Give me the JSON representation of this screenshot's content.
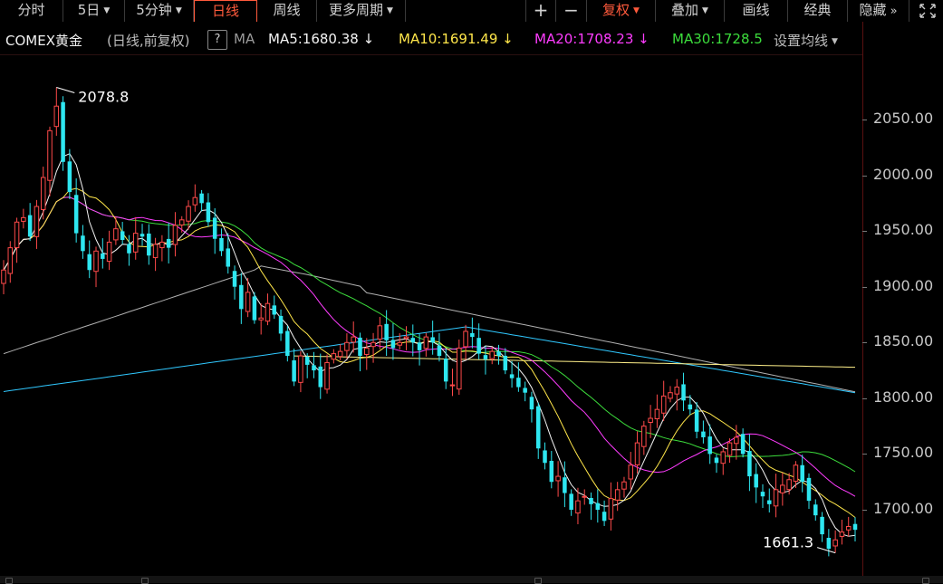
{
  "toolbar": {
    "left_tabs": [
      {
        "label": "分时",
        "dropdown": false,
        "active": false
      },
      {
        "label": "5日",
        "dropdown": true,
        "active": false
      },
      {
        "label": "5分钟",
        "dropdown": true,
        "active": false
      },
      {
        "label": "日线",
        "dropdown": false,
        "active": true
      },
      {
        "label": "周线",
        "dropdown": false,
        "active": false
      },
      {
        "label": "更多周期",
        "dropdown": true,
        "active": false
      }
    ],
    "zoom_in": "+",
    "zoom_out": "−",
    "right_buttons": [
      {
        "label": "复权",
        "dropdown": true,
        "highlight": true
      },
      {
        "label": "叠加",
        "dropdown": true,
        "highlight": false
      },
      {
        "label": "画线",
        "dropdown": false,
        "highlight": false
      },
      {
        "label": "经典",
        "dropdown": false,
        "highlight": false
      },
      {
        "label": "隐藏",
        "dropdown": false,
        "highlight": false
      }
    ],
    "hide_arrow": "»",
    "fullscreen_icon": "fullscreen-icon"
  },
  "legend": {
    "name": "COMEX黄金",
    "sub": "(日线,前复权)",
    "help": "?",
    "ma_label": "MA",
    "ma5": "MA5:1680.38",
    "ma10": "MA10:1691.49",
    "ma20": "MA20:1708.23",
    "ma30": "MA30:1728.5",
    "arrow_down": "↓",
    "settings": "设置均线"
  },
  "colors": {
    "up": "#ff4a4a",
    "down": "#2ee6f0",
    "ma5": "#f4f4f4",
    "ma10": "#ffe64a",
    "ma20": "#ff3cff",
    "ma30": "#3cdc3c",
    "ma60": "#cfcfcf",
    "ma120": "#30c8ff",
    "ma250": "#fff08a",
    "accent": "#ff5a3c"
  },
  "chart_data": {
    "type": "candlestick",
    "y_ticks": [
      "2050.00",
      "2000.00",
      "1950.00",
      "1900.00",
      "1850.00",
      "1800.00",
      "1750.00",
      "1700.00"
    ],
    "ylim": [
      1657,
      2085
    ],
    "high_label": "2078.8",
    "low_label": "1661.3",
    "closes": [
      1915,
      1935,
      1958,
      1962,
      1945,
      1972,
      1998,
      2040,
      2062,
      2012,
      1985,
      1948,
      1932,
      1915,
      1932,
      1925,
      1940,
      1952,
      1942,
      1930,
      1948,
      1945,
      1928,
      1938,
      1940,
      1935,
      1955,
      1960,
      1972,
      1980,
      1975,
      1958,
      1943,
      1932,
      1918,
      1900,
      1880,
      1895,
      1870,
      1872,
      1885,
      1875,
      1858,
      1838,
      1815,
      1838,
      1830,
      1825,
      1810,
      1832,
      1840,
      1842,
      1850,
      1855,
      1838,
      1845,
      1850,
      1865,
      1852,
      1845,
      1850,
      1855,
      1850,
      1843,
      1855,
      1850,
      1838,
      1815,
      1812,
      1845,
      1860,
      1855,
      1840,
      1835,
      1842,
      1838,
      1825,
      1818,
      1810,
      1805,
      1790,
      1755,
      1742,
      1725,
      1730,
      1715,
      1700,
      1708,
      1712,
      1705,
      1700,
      1690,
      1710,
      1718,
      1725,
      1740,
      1760,
      1775,
      1782,
      1790,
      1802,
      1805,
      1810,
      1798,
      1790,
      1770,
      1765,
      1750,
      1742,
      1752,
      1760,
      1765,
      1750,
      1730,
      1720,
      1712,
      1705,
      1718,
      1722,
      1727,
      1740,
      1725,
      1708,
      1695,
      1678,
      1665,
      1673,
      1680,
      1685,
      1682
    ],
    "ma60_start": 36,
    "ma120_start": 76,
    "ma250_start": 44
  }
}
